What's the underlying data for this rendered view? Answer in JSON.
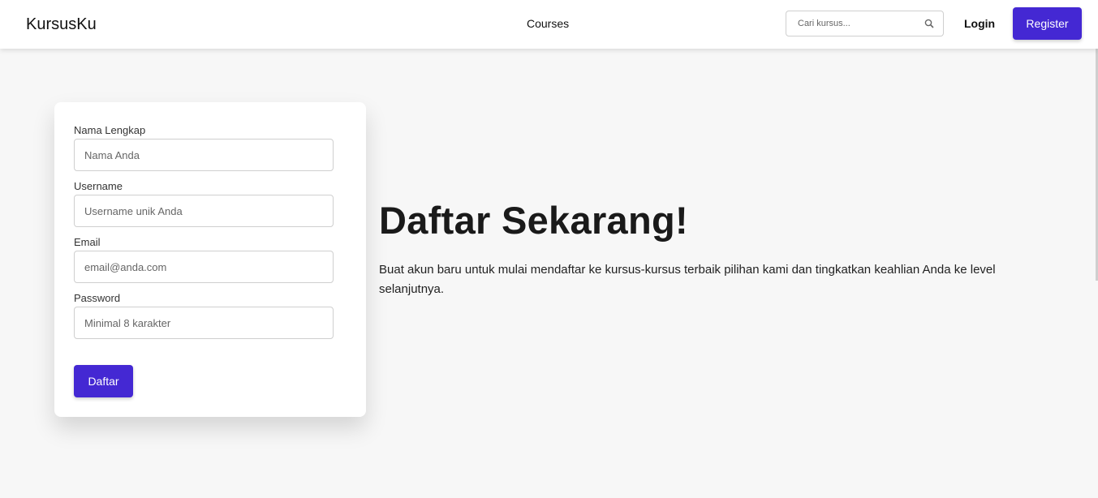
{
  "navbar": {
    "brand": "KursusKu",
    "courses_link": "Courses",
    "search_placeholder": "Cari kursus...",
    "login_label": "Login",
    "register_label": "Register"
  },
  "form": {
    "fields": [
      {
        "label": "Nama Lengkap",
        "placeholder": "Nama Anda",
        "value": ""
      },
      {
        "label": "Username",
        "placeholder": "Username unik Anda",
        "value": ""
      },
      {
        "label": "Email",
        "placeholder": "email@anda.com",
        "value": ""
      },
      {
        "label": "Password",
        "placeholder": "Minimal 8 karakter",
        "value": ""
      }
    ],
    "submit_label": "Daftar"
  },
  "hero": {
    "title": "Daftar Sekarang!",
    "description": "Buat akun baru untuk mulai mendaftar ke kursus-kursus terbaik pilihan kami dan tingkatkan keahlian Anda ke level selanjutnya."
  },
  "icons": {
    "search": "search-icon"
  },
  "colors": {
    "accent": "#4428d3",
    "background": "#f7f7f7",
    "card": "#ffffff"
  }
}
